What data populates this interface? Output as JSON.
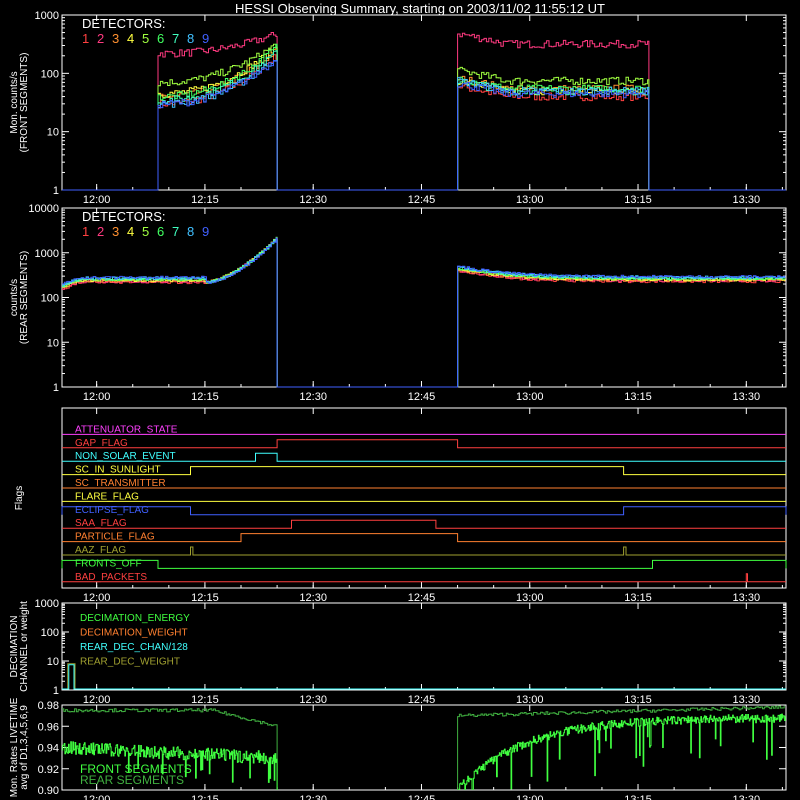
{
  "title": "HESSI Observing Summary, starting on 2003/11/02 11:55:12 UT",
  "colors": {
    "det": [
      "#ff4040",
      "#ff3a80",
      "#ff9030",
      "#ffff40",
      "#a0ff40",
      "#40ff60",
      "#40ffc0",
      "#40c0ff",
      "#4060ff"
    ],
    "axis": "#ffffff",
    "magenta": "#ff40ff",
    "green_front": "#40ff40",
    "green_rear": "#40b040"
  },
  "x_time_axis": {
    "start": "11:55:12",
    "end": "13:35:30",
    "ticks": [
      "12:00",
      "12:15",
      "12:30",
      "12:45",
      "13:00",
      "13:15",
      "13:30"
    ]
  },
  "chart_data": [
    {
      "type": "line",
      "panel": "front",
      "ylabel": "Mon. counts/s\n(FRONT SEGMENTS)",
      "yscale": "log",
      "ylim": [
        1,
        1000
      ],
      "yticks": [
        "1",
        "10",
        "100",
        "1000"
      ],
      "legend_title": "DETECTORS:",
      "legend_items": [
        "1",
        "2",
        "3",
        "4",
        "5",
        "6",
        "7",
        "8",
        "9"
      ],
      "data_intervals": [
        [
          "12:08:30",
          "12:25:00"
        ],
        [
          "12:50:00",
          "13:16:30"
        ]
      ],
      "series_levels_start": [
        30,
        220,
        40,
        45,
        70,
        40,
        35,
        30,
        30
      ],
      "series_levels_end": [
        210,
        480,
        260,
        300,
        330,
        300,
        240,
        200,
        190
      ],
      "series_levels_second": [
        40,
        320,
        55,
        50,
        75,
        55,
        50,
        50,
        45
      ]
    },
    {
      "type": "line",
      "panel": "rear",
      "ylabel": "counts/s\n(REAR SEGMENTS)",
      "yscale": "log",
      "ylim": [
        1,
        10000
      ],
      "yticks": [
        "1",
        "10",
        "100",
        "1000",
        "10000"
      ],
      "legend_title": "DETECTORS:",
      "legend_items": [
        "1",
        "2",
        "3",
        "4",
        "5",
        "6",
        "7",
        "8",
        "9"
      ],
      "data_intervals": [
        [
          "11:55:12",
          "12:25:00"
        ],
        [
          "12:50:00",
          "13:35:30"
        ]
      ],
      "baseline": 250,
      "peak_at_12_25": 2500,
      "second_start": 450,
      "second_end": 260
    },
    {
      "type": "step",
      "panel": "flags",
      "ylabel": "Flags",
      "flags": [
        {
          "name": "ATTENUATOR_STATE",
          "color": "#ff40ff",
          "high": []
        },
        {
          "name": "GAP_FLAG",
          "color": "#ff4040",
          "high": [
            [
              "12:25:00",
              "12:50:00"
            ]
          ]
        },
        {
          "name": "NON_SOLAR_EVENT",
          "color": "#40ffff",
          "high": [
            [
              "12:22:00",
              "12:25:00"
            ]
          ]
        },
        {
          "name": "SC_IN_SUNLIGHT",
          "color": "#ffff40",
          "high": [
            [
              "12:13:00",
              "13:13:00"
            ]
          ]
        },
        {
          "name": "SC_TRANSMITTER",
          "color": "#ff8030",
          "high": []
        },
        {
          "name": "FLARE_FLAG",
          "color": "#ffff40",
          "high": []
        },
        {
          "name": "ECLIPSE_FLAG",
          "color": "#4060ff",
          "high": [
            [
              "11:55:12",
              "12:13:00"
            ],
            [
              "13:13:00",
              "13:35:30"
            ]
          ]
        },
        {
          "name": "SAA_FLAG",
          "color": "#ff4040",
          "high": [
            [
              "12:27:00",
              "12:47:00"
            ]
          ]
        },
        {
          "name": "PARTICLE_FLAG",
          "color": "#ff8030",
          "high": [
            [
              "12:20:00",
              "12:50:00"
            ]
          ]
        },
        {
          "name": "AAZ_FLAG",
          "color": "#a0a030",
          "high": [
            [
              "12:13:00",
              "12:13:20"
            ],
            [
              "13:13:00",
              "13:13:20"
            ]
          ]
        },
        {
          "name": "FRONTS_OFF",
          "color": "#40ff40",
          "high": [
            [
              "11:55:12",
              "12:08:30"
            ],
            [
              "13:17:00",
              "13:35:30"
            ]
          ]
        },
        {
          "name": "BAD_PACKETS",
          "color": "#ff4040",
          "high": [
            [
              "13:30:00",
              "13:30:10"
            ]
          ]
        }
      ]
    },
    {
      "type": "line",
      "panel": "decimation",
      "ylabel": "DECIMATION\nCHANNEL or weight",
      "yscale": "log",
      "ylim": [
        1,
        1000
      ],
      "yticks": [
        "1",
        "10",
        "100",
        "1000"
      ],
      "legend_items": [
        {
          "name": "DECIMATION_ENERGY",
          "color": "#40ff40"
        },
        {
          "name": "DECIMATION_WEIGHT",
          "color": "#ff8030"
        },
        {
          "name": "REAR_DEC_CHAN/128",
          "color": "#40ffff"
        },
        {
          "name": "REAR_DEC_WEIGHT",
          "color": "#a0a030"
        }
      ],
      "spike": {
        "start": "11:56:00",
        "end": "11:57:00",
        "value": 8
      }
    },
    {
      "type": "line",
      "panel": "livetime",
      "ylabel": "Mon. Rates LIVETIME\navg of D1,3,4,5,6,9",
      "ylim": [
        0.9,
        0.98
      ],
      "yticks": [
        "0.90",
        "0.92",
        "0.94",
        "0.96",
        "0.98"
      ],
      "legend_items": [
        {
          "name": "FRONT SEGMENTS",
          "color": "#40ff40"
        },
        {
          "name": "REAR SEGMENTS",
          "color": "#40b040"
        }
      ],
      "rear_levels": {
        "first": 0.975,
        "end_first": 0.96,
        "second": 0.97,
        "end_second": 0.978
      },
      "front_levels": {
        "first": 0.94,
        "end_first": 0.93,
        "second_start": 0.9,
        "second_end": 0.968
      }
    }
  ]
}
